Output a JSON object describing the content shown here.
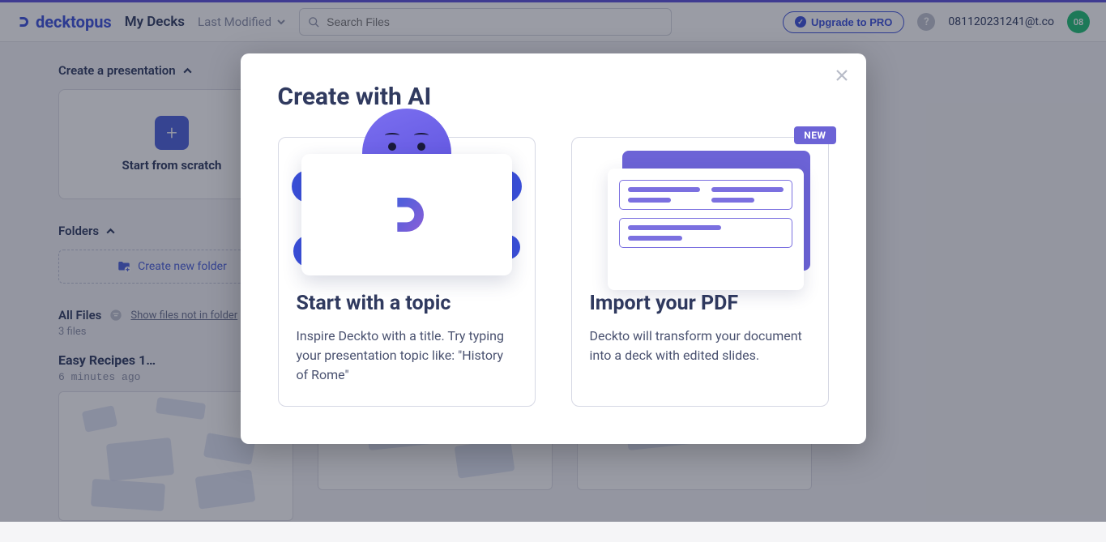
{
  "brand": "decktopus",
  "header": {
    "page_title": "My Decks",
    "sort_label": "Last Modified",
    "search_placeholder": "Search Files",
    "upgrade_label": "Upgrade to PRO",
    "user_email": "081120231241@t.co",
    "avatar_initials": "08"
  },
  "sections": {
    "create_label": "Create a presentation",
    "scratch_label": "Start from scratch",
    "folders_label": "Folders",
    "new_folder_label": "Create new folder",
    "all_files_label": "All Files",
    "show_not_in_folder": "Show files not in folder",
    "file_count": "3 files"
  },
  "files": [
    {
      "title": "Easy Recipes 1…",
      "time": "6 minutes ago"
    },
    {
      "title": "",
      "time": ""
    },
    {
      "title": "",
      "time": ""
    }
  ],
  "modal": {
    "title": "Create with AI",
    "options": [
      {
        "title": "Start with a topic",
        "desc": "Inspire Deckto with a title. Try typing your presentation topic like: \"History of Rome\"",
        "badge": null
      },
      {
        "title": "Import your PDF",
        "desc": "Deckto will transform your document into a deck with edited slides.",
        "badge": "NEW"
      }
    ]
  }
}
